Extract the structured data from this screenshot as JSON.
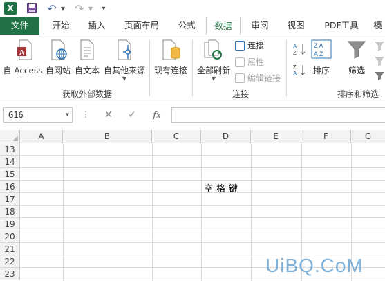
{
  "qat": {
    "app_icon": "excel-icon",
    "app_letter": "X",
    "save_icon": "save-icon",
    "undo_icon": "undo-icon",
    "redo_icon": "redo-icon"
  },
  "tabs": [
    {
      "label": "文件"
    },
    {
      "label": "开始"
    },
    {
      "label": "插入"
    },
    {
      "label": "页面布局"
    },
    {
      "label": "公式"
    },
    {
      "label": "数据"
    },
    {
      "label": "审阅"
    },
    {
      "label": "视图"
    },
    {
      "label": "PDF工具"
    },
    {
      "label": "模"
    }
  ],
  "ribbon": {
    "get_external": {
      "access": "自 Access",
      "web": "自网站",
      "text": "自文本",
      "other": "自其他来源",
      "group": "获取外部数据"
    },
    "existing_connections": "现有连接",
    "refresh_all": "全部刷新",
    "connections": {
      "connect": "连接",
      "properties": "属性",
      "edit_links": "编辑链接",
      "group": "连接"
    },
    "sort_filter": {
      "sort": "排序",
      "filter": "筛选",
      "group": "排序和筛选"
    }
  },
  "formula_bar": {
    "name_box": "G16",
    "cancel": "✕",
    "enter": "✓",
    "fx": "fx",
    "value": ""
  },
  "grid": {
    "columns": [
      "A",
      "B",
      "C",
      "D",
      "E",
      "F",
      "G"
    ],
    "rows": [
      "13",
      "14",
      "15",
      "16",
      "17",
      "18",
      "19",
      "20",
      "21",
      "22",
      "23"
    ],
    "cell_d16": "空格键"
  },
  "watermark": "UiBQ.CoM",
  "colors": {
    "brand": "#217346",
    "grid_line": "#dadada",
    "header_bg": "#f3f3f3"
  }
}
